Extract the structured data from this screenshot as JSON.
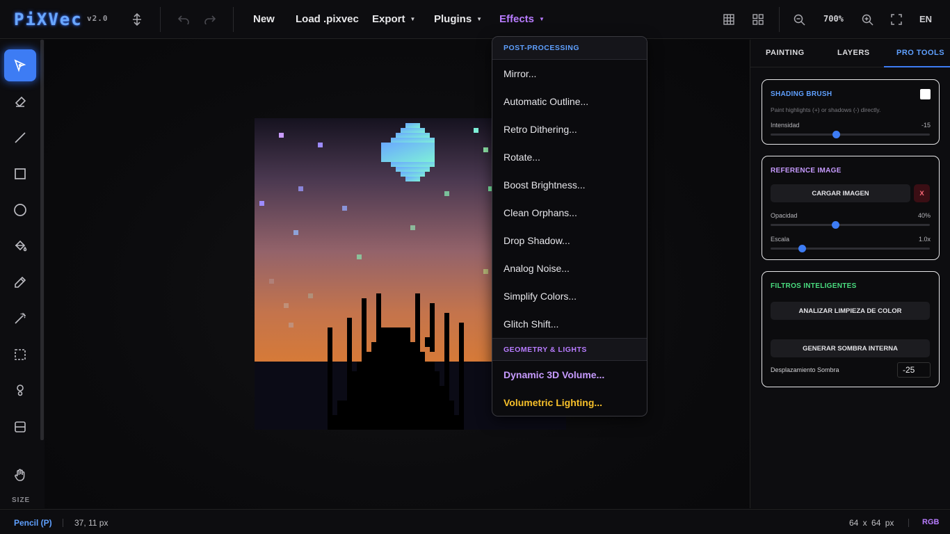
{
  "app": {
    "logo": "PiXVec",
    "version": "v2.0"
  },
  "menubar": {
    "new": "New",
    "load": "Load .pixvec",
    "export": "Export",
    "plugins": "Plugins",
    "effects": "Effects"
  },
  "view": {
    "zoom": "700%",
    "language": "EN"
  },
  "effects_menu": {
    "section_post": "POST-PROCESSING",
    "items": [
      "Mirror...",
      "Automatic Outline...",
      "Retro Dithering...",
      "Rotate...",
      "Boost Brightness...",
      "Clean Orphans...",
      "Drop Shadow...",
      "Analog Noise...",
      "Simplify Colors...",
      "Glitch Shift..."
    ],
    "section_geo": "GEOMETRY & LIGHTS",
    "geo_items": [
      "Dynamic 3D Volume...",
      "Volumetric Lighting..."
    ]
  },
  "toolbar": {
    "size_label": "SIZE"
  },
  "tabs": [
    "PAINTING",
    "LAYERS",
    "PRO TOOLS"
  ],
  "shading": {
    "title": "SHADING BRUSH",
    "desc": "Paint highlights (+) or shadows (-) directly.",
    "intensity_label": "Intensidad",
    "intensity_value": "-15"
  },
  "reference": {
    "title": "REFERENCE IMAGE",
    "load_button": "CARGAR IMAGEN",
    "remove_button": "X",
    "opacity_label": "Opacidad",
    "opacity_value": "40%",
    "scale_label": "Escala",
    "scale_value": "1.0x"
  },
  "filters": {
    "title": "FILTROS INTELIGENTES",
    "analyze_button": "ANALIZAR LIMPIEZA DE COLOR",
    "shadow_button": "GENERAR SOMBRA INTERNA",
    "offset_label": "Desplazamiento Sombra",
    "offset_value": "-25"
  },
  "status": {
    "tool": "Pencil (P)",
    "coords": "37, 11 px",
    "dimensions": "64 x 64 px",
    "mode": "RGB"
  },
  "colors": {
    "accent": "#3d7cf4",
    "purple": "#b87cff",
    "gold": "#f7c02a",
    "green": "#4ade80"
  }
}
